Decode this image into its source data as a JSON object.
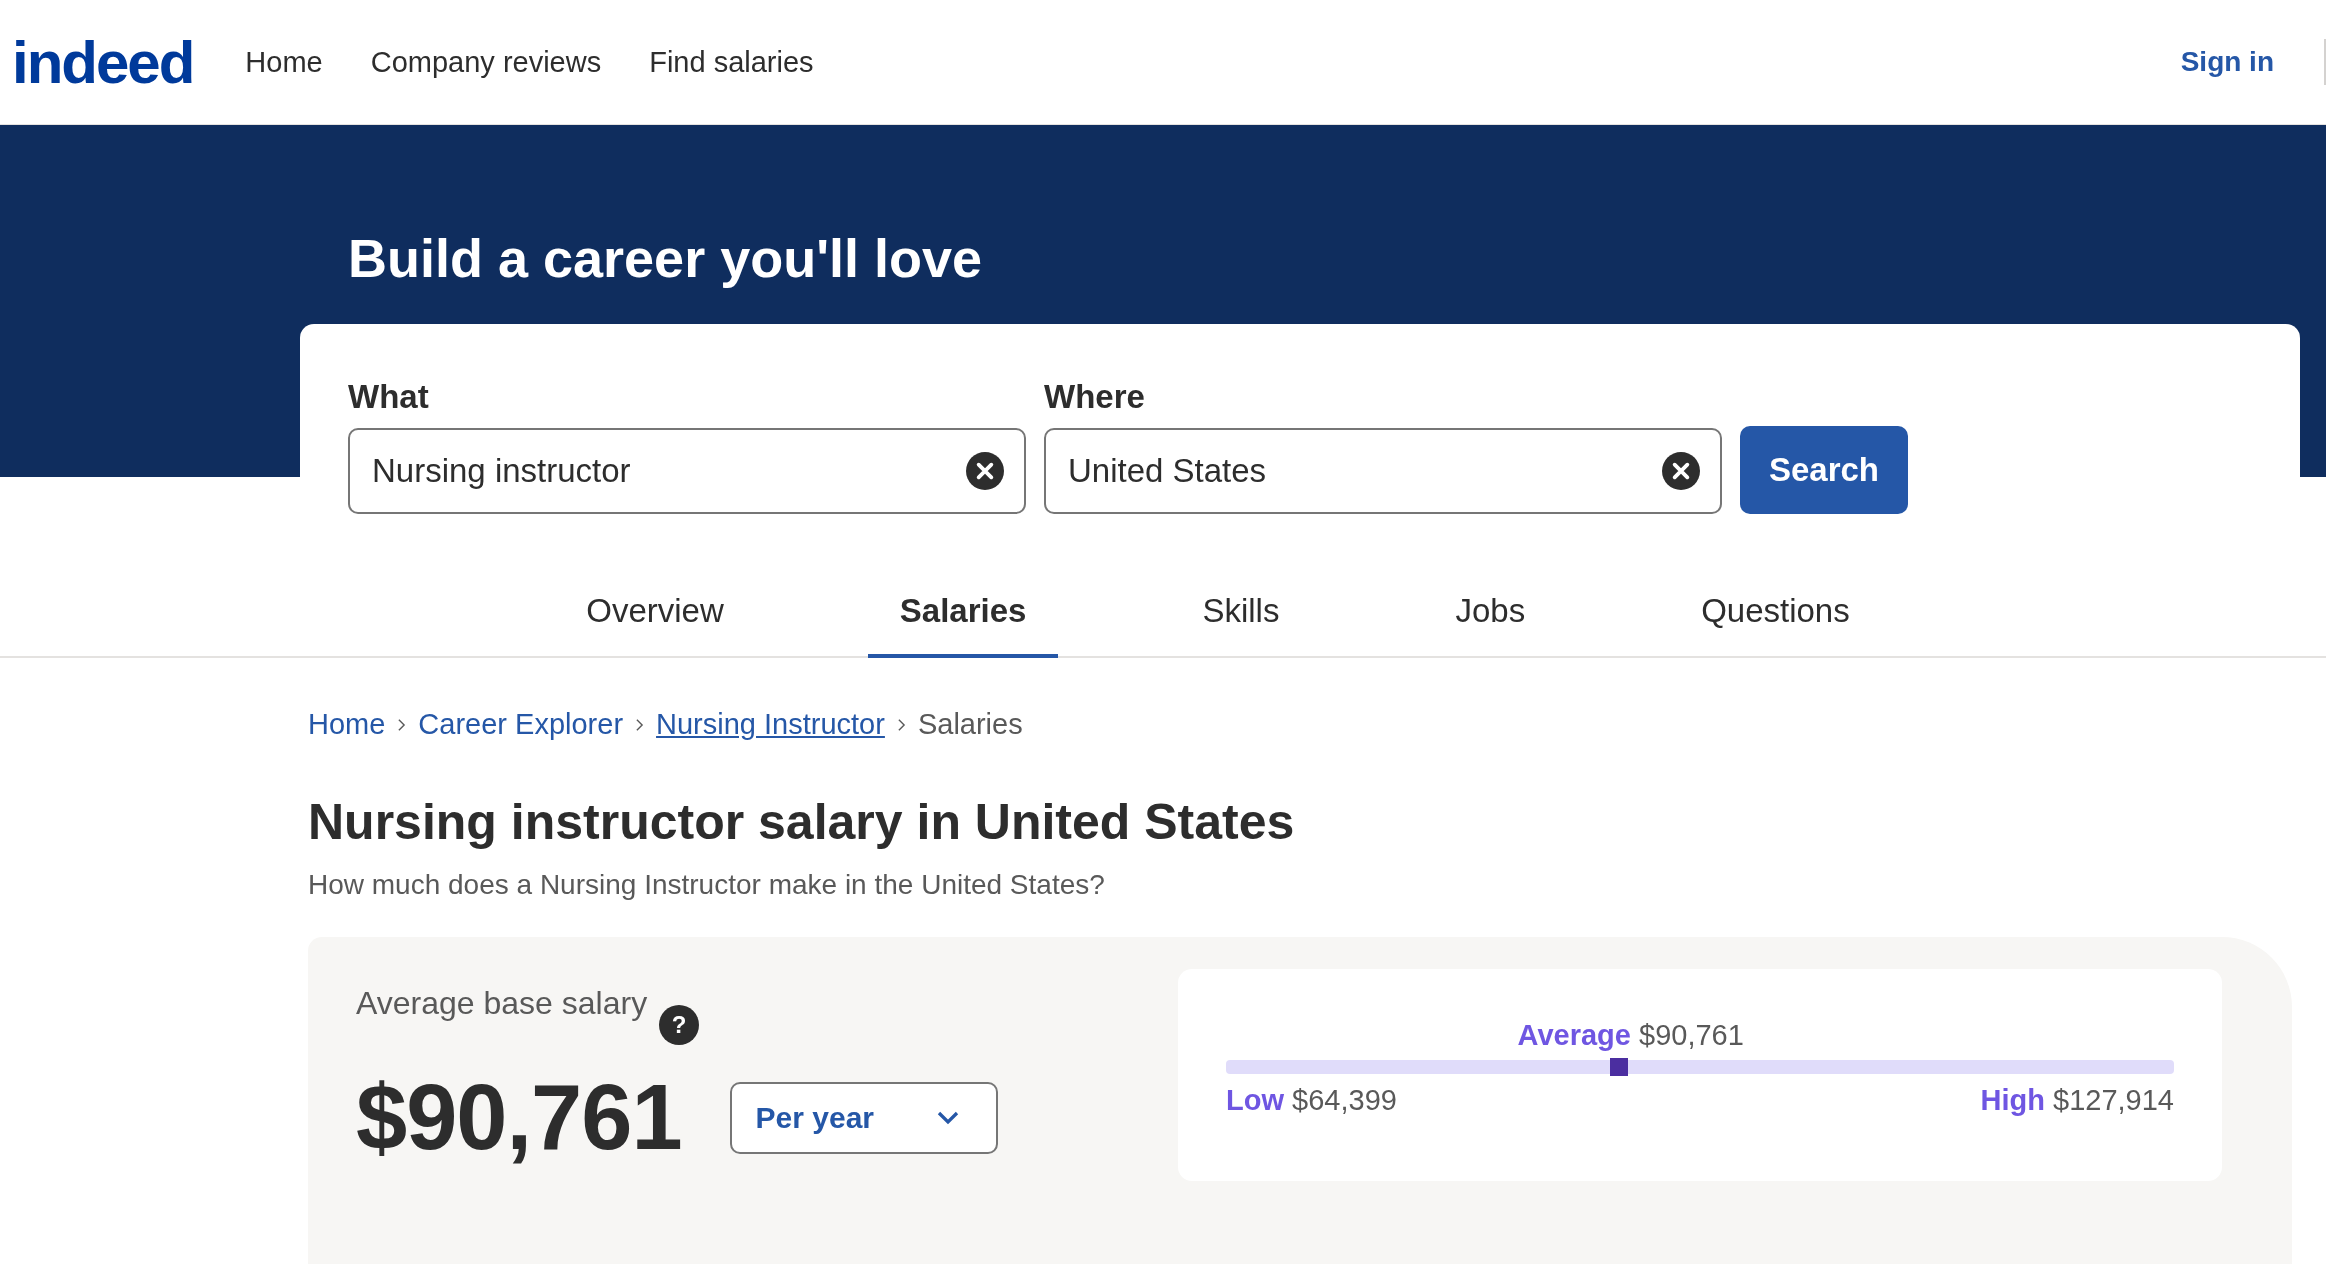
{
  "header": {
    "logo": "indeed",
    "nav": [
      {
        "label": "Home"
      },
      {
        "label": "Company reviews"
      },
      {
        "label": "Find salaries"
      }
    ],
    "sign_in": "Sign in"
  },
  "hero": {
    "title": "Build a career you'll love"
  },
  "search": {
    "what": {
      "label": "What",
      "value": "Nursing instructor"
    },
    "where": {
      "label": "Where",
      "value": "United States"
    },
    "button": "Search"
  },
  "tabs": [
    {
      "label": "Overview",
      "selected": false
    },
    {
      "label": "Salaries",
      "selected": true
    },
    {
      "label": "Skills",
      "selected": false
    },
    {
      "label": "Jobs",
      "selected": false
    },
    {
      "label": "Questions",
      "selected": false
    }
  ],
  "breadcrumb": [
    {
      "label": "Home",
      "kind": "link"
    },
    {
      "label": "Career Explorer",
      "kind": "link"
    },
    {
      "label": "Nursing Instructor",
      "kind": "underlined"
    },
    {
      "label": "Salaries",
      "kind": "current"
    }
  ],
  "page_title": "Nursing instructor salary in United States",
  "subtitle": "How much does a Nursing Instructor make in the United States?",
  "salary": {
    "label": "Average base salary",
    "help": "?",
    "amount": "$90,761",
    "period": "Per year",
    "range": {
      "average_label": "Average",
      "average": "$90,761",
      "level": 0.415,
      "low_label": "Low",
      "low": "$64,399",
      "high_label": "High",
      "high": "$127,914"
    }
  }
}
